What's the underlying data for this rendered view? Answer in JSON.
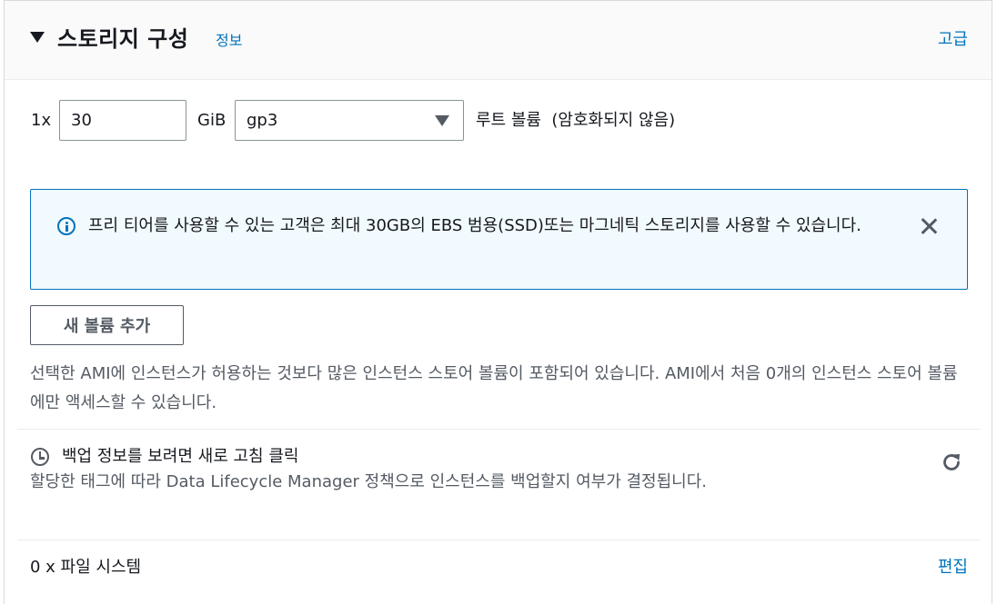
{
  "header": {
    "title": "스토리지 구성",
    "info_link": "정보",
    "advanced_link": "고급"
  },
  "volume": {
    "count_label": "1x",
    "size_value": "30",
    "unit": "GiB",
    "type_selected": "gp3",
    "description": "루트 볼륨  (암호화되지 않음)"
  },
  "alert": {
    "message": "프리 티어를 사용할 수 있는 고객은 최대 30GB의 EBS 범용(SSD)또는 마그네틱 스토리지를 사용할 수 있습니다."
  },
  "add_volume_button": "새 볼륨 추가",
  "instance_store_note": "선택한 AMI에 인스턴스가 허용하는 것보다 많은 인스턴스 스토어 볼륨이 포함되어 있습니다. AMI에서 처음 0개의 인스턴스 스토어 볼륨에만 액세스할 수 있습니다.",
  "backup": {
    "title": "백업 정보를 보려면 새로 고침 클릭",
    "description": "할당한 태그에 따라 Data Lifecycle Manager 정책으로 인스턴스를 백업할지 여부가 결정됩니다."
  },
  "file_systems": {
    "label": "0 x 파일 시스템",
    "edit_link": "편집"
  }
}
